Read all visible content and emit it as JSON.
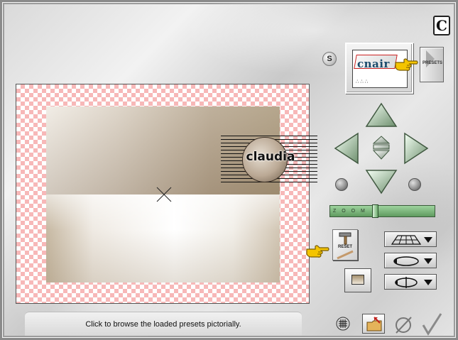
{
  "logo_letter": "C",
  "s_button_label": "S",
  "preset_thumbnail": {
    "brand_text": "cnair",
    "dots": "∴ ∴ ∴"
  },
  "presets_button_label": "PRESETS",
  "watermark_text": "claudia",
  "zoom_slider": {
    "ticks": "Z O O M",
    "position_fraction": 0.4
  },
  "reset_button_label": "RESET",
  "status_text": "Click to browse the loaded presets pictorially.",
  "colors": {
    "checker_pink": "#f7b8b8",
    "slider_green": "#7bb87b",
    "hand_yellow": "#f4c400"
  },
  "icons": {
    "logo": "c-logo-icon",
    "up": "arrow-up-icon",
    "down": "arrow-down-icon",
    "left": "arrow-left-icon",
    "right": "arrow-right-icon",
    "center": "center-diamond-icon",
    "rotate_left": "rotate-ccw-ball-icon",
    "rotate_right": "rotate-cw-ball-icon",
    "perspective": "perspective-grid-icon",
    "rotate_plane": "rotate-ellipse-icon",
    "flip": "flip-axis-icon",
    "grid": "grid-icon",
    "folder": "folder-icon",
    "cancel": "cancel-icon",
    "ok": "checkmark-icon"
  }
}
